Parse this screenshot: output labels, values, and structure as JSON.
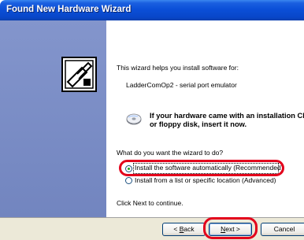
{
  "window": {
    "title": "Found New Hardware Wizard"
  },
  "main": {
    "intro_text": "This wizard helps you install software for:",
    "device_name": "LadderComOp2 - serial port emulator",
    "cd_note_line1": "If your hardware came with an installation CD",
    "cd_note_line2": "or floppy disk, insert it now.",
    "question": "What do you want the wizard to do?",
    "options": [
      {
        "label": "Install the software automatically (Recommended)",
        "selected": true
      },
      {
        "label": "Install from a list or specific location (Advanced)",
        "selected": false
      }
    ],
    "continue_text": "Click Next to continue."
  },
  "buttons": {
    "back_u": "B",
    "back_rest": "ack",
    "back_prefix": "< ",
    "next_u": "N",
    "next_rest": "ext >",
    "cancel": "Cancel"
  },
  "colors": {
    "titlebar": "#0b4fd8",
    "left_panel": "#7b8fc5",
    "highlight": "#e3001b",
    "bottom_bar": "#ece9d8"
  }
}
